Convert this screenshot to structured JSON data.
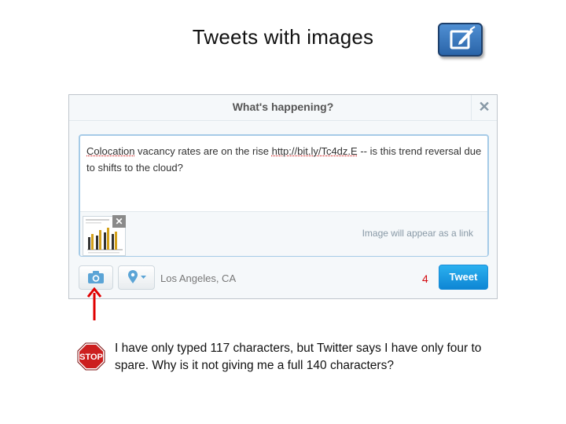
{
  "slide": {
    "title": "Tweets with images",
    "note": "I have only typed 117 characters, but Twitter says I have only four to spare.  Why is it not giving me a full 140 characters?"
  },
  "icons": {
    "compose": "compose-tweet-icon",
    "close": "close-icon",
    "camera": "camera-icon",
    "location": "location-pin-icon",
    "dropdown": "chevron-down-icon",
    "arrow": "red-up-arrow-icon",
    "stop": "stop-sign-icon"
  },
  "dialog": {
    "title": "What's happening?",
    "close_glyph": "✕",
    "tweet": {
      "part1": "Colocation",
      "part2": " vacancy rates are on the rise ",
      "link": "http://bit.ly/Tc4dz.E",
      "part3": " -- is this trend reversal due to shifts to the cloud?"
    },
    "attachment": {
      "remove_glyph": "✕",
      "note": "Image will appear as a link"
    },
    "location": "Los Angeles, CA",
    "remaining_chars": "4",
    "tweet_button": "Tweet"
  },
  "colors": {
    "tweet_button": "#1da1f2",
    "count_warning": "#d40d12",
    "arrow": "#e00000",
    "stop": "#cc1f1f"
  }
}
